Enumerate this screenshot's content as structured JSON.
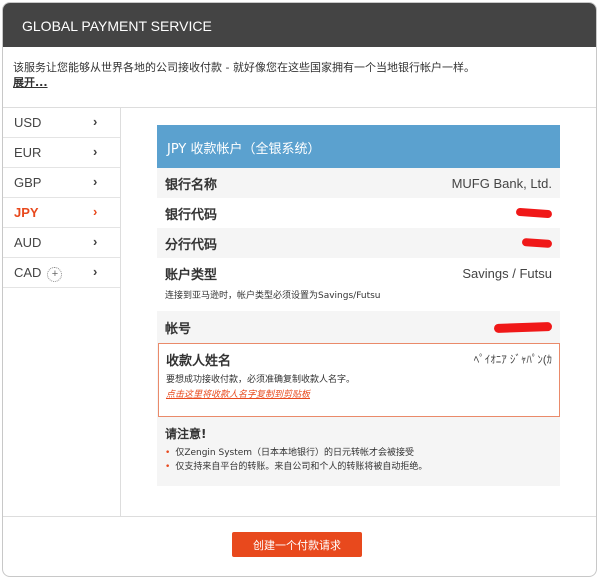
{
  "header": {
    "title": "GLOBAL PAYMENT SERVICE"
  },
  "intro": {
    "text": "该服务让您能够从世界各地的公司接收付款 - 就好像您在这些国家拥有一个当地银行帐户一样。",
    "expand": "展开..."
  },
  "sidebar": {
    "items": [
      {
        "label": "USD"
      },
      {
        "label": "EUR"
      },
      {
        "label": "GBP"
      },
      {
        "label": "JPY",
        "active": true
      },
      {
        "label": "AUD"
      },
      {
        "label": "CAD",
        "plus": "+"
      }
    ],
    "chevron": "›"
  },
  "panel": {
    "title": "JPY 收款帐户（全银系统）",
    "bank_name": {
      "label": "银行名称",
      "value": "MUFG Bank, Ltd."
    },
    "bank_code": {
      "label": "银行代码"
    },
    "branch_code": {
      "label": "分行代码"
    },
    "account_type": {
      "label": "账户类型",
      "value": "Savings / Futsu",
      "note": "连接到亚马逊时，帐户类型必须设置为Savings/Futsu"
    },
    "account_number": {
      "label": "帐号"
    },
    "payee": {
      "label": "收款人姓名",
      "value": "ﾍﾟｲｵﾆｱ ｼﾞｬﾊﾟﾝ(ｶ",
      "hint": "要想成功接收付款，必须准确复制收款人名字。",
      "copy_link": "点击这里将收款人名字复制到剪贴板"
    },
    "notice": {
      "title": "请注意!",
      "items": [
        "仅Zengin System（日本本地银行）的日元转帐才会被接受",
        "仅支持来自平台的转账。来自公司和个人的转账将被自动拒绝。"
      ]
    }
  },
  "footer": {
    "button": "创建一个付款请求"
  },
  "colors": {
    "accent": "#e8491d",
    "panel_header": "#5ba1cf",
    "header": "#444444"
  }
}
